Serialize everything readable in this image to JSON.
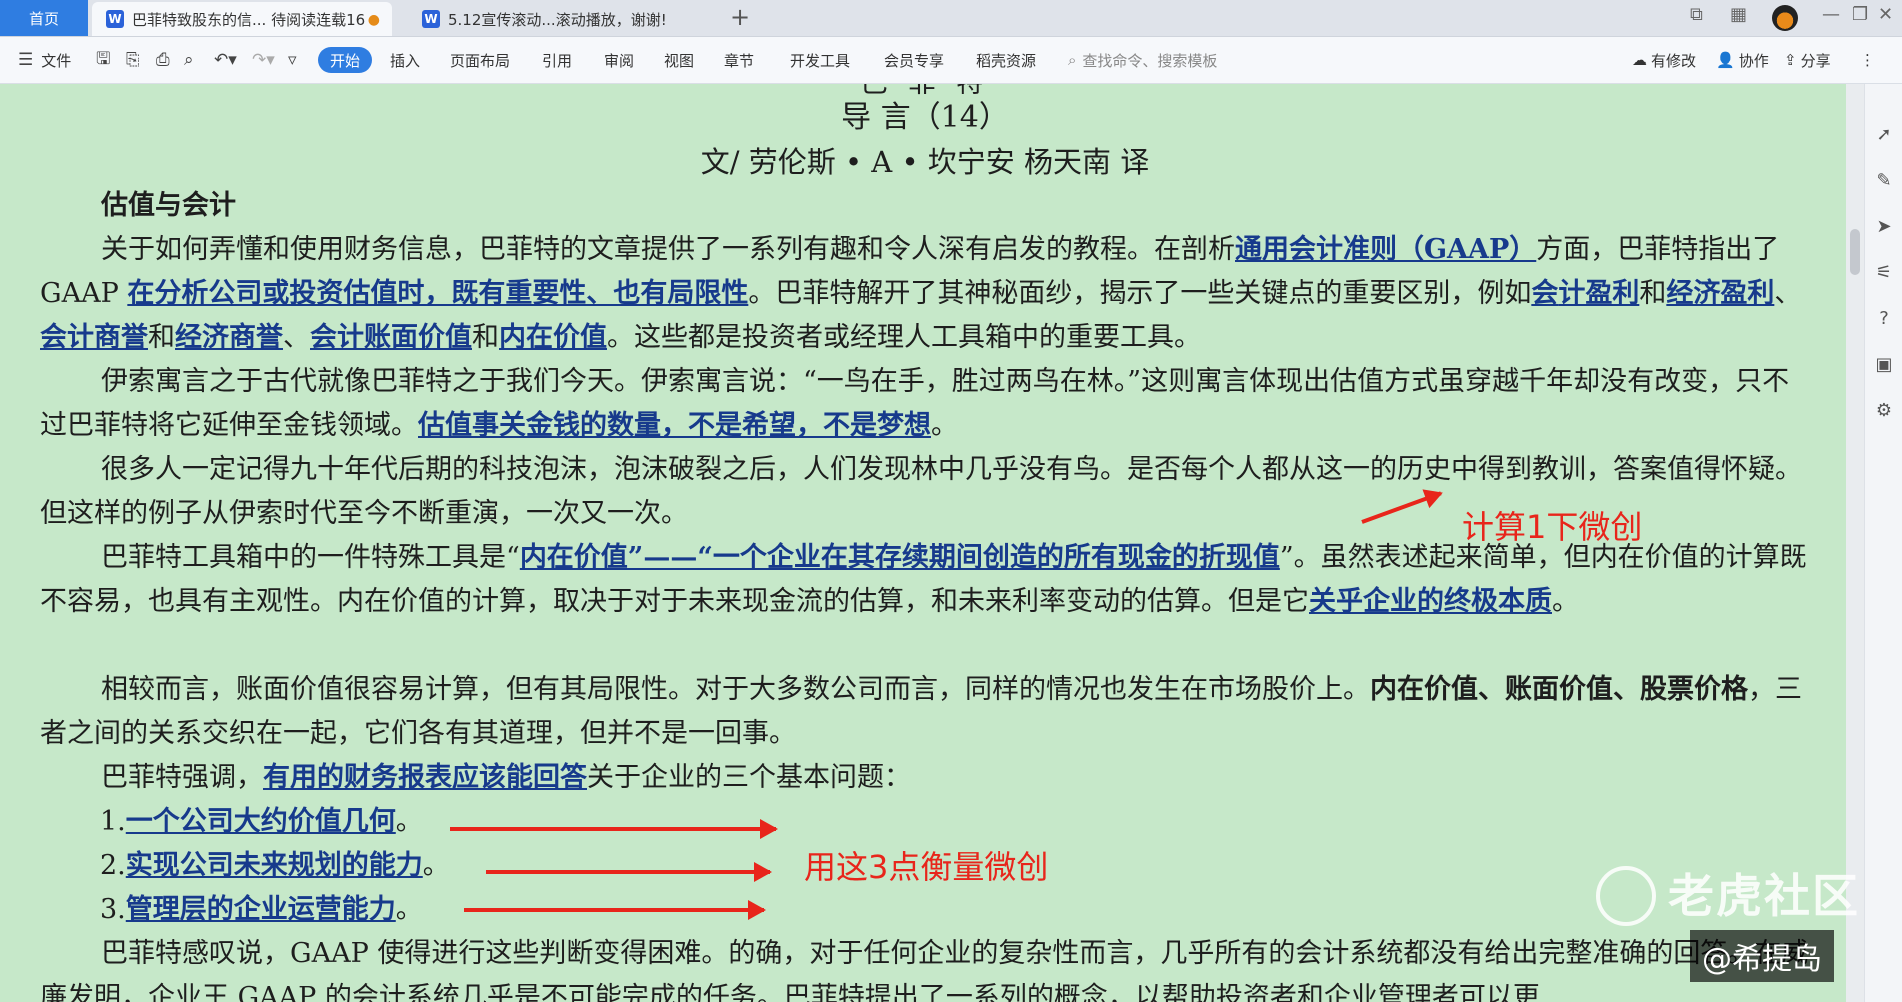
{
  "titlebar": {
    "home_tab": "首页",
    "tabs": [
      {
        "label": "巴菲特致股东的信... 待阅读连载16",
        "icon": "W",
        "modified": "●"
      },
      {
        "label": "5.12宣传滚动...滚动播放，谢谢!",
        "icon": "W"
      }
    ],
    "add_tab": "+"
  },
  "toolbar": {
    "file_menu": "文件",
    "menus": [
      "开始",
      "插入",
      "页面布局",
      "引用",
      "审阅",
      "视图",
      "章节",
      "开发工具",
      "会员专享",
      "稻壳资源"
    ],
    "search_placeholder": "查找命令、搜索模板",
    "right": {
      "changes": "有修改",
      "collab": "协作",
      "share": "分享"
    }
  },
  "document": {
    "heading_partial": "巴 菲 特",
    "heading": "导 言（14）",
    "byline": "文/ 劳伦斯 • A • 坎宁安   杨天南 译",
    "section_title": "估值与会计",
    "p1": {
      "a": "关于如何弄懂和使用财务信息，巴菲特的文章提供了一系列有趣和令人深有启发的教程。在剖析",
      "u1": "通用会计准则（GAAP）",
      "b": "方面，巴菲",
      "c": "特指出了 GAAP ",
      "u2": "在分析公司或投资估值时，既有重要性、也有局限性",
      "d": "。巴菲特解开了其神秘面纱，揭示了一些关键点的重要区别，例如",
      "u3": "会",
      "u3b": "计盈利",
      "and1": "和",
      "u4": "经济盈利",
      "sep1": "、",
      "u5": "会计商誉",
      "and2": "和",
      "u6": "经济商誉",
      "sep2": "、",
      "u7": "会计账面价值",
      "and3": "和",
      "u8": "内在价值",
      "e": "。这些都是投资者或经理人工具箱中的重要工具。"
    },
    "p2": {
      "a": "伊索寓言之于古代就像巴菲特之于我们今天。伊索寓言说：“一鸟在手，胜过两鸟在林。”这则寓言体现出估值方式虽穿越千年却",
      "b": "没有改变，只不过巴菲特将它延伸至金钱领域。",
      "u1": "估值事关金钱的数量，不是希望，不是梦想",
      "c": "。"
    },
    "p3": {
      "a": "很多人一定记得九十年代后期的科技泡沫，泡沫破裂之后，人们发现林中几乎没有鸟。是否每个人都从这一的历史中得到教训，答",
      "b": "案值得怀疑。但这样的例子从伊索时代至今不断重演，一次又一次。"
    },
    "p4": {
      "a": "巴菲特工具箱中的一件特殊工具是“",
      "u1": "内在价值”——“一个企业在其存续期间创造的所有现金的折现值",
      "b": "”。虽然表述起来简单，但",
      "c": "内在价值的计算既不容易，也具有主观性。内在价值的计算，取决于对于未来现金流的估算，和未来利率变动的估算。但是它",
      "u2": "关乎企业",
      "u2b": "的终极本质",
      "d": "。"
    },
    "p5": {
      "a": "相较而言，账面价值很容易计算，但有其局限性。对于大多数公司而言，同样的情况也发生在市场股价上。",
      "b1": "内在价值、账面价值、",
      "b2": "股票价格",
      "c": "，三者之间的关系交织在一起，它们各有其道理，但并不是一回事。"
    },
    "p6": {
      "a": "巴菲特强调，",
      "u1": "有用的财务报表应该能回答",
      "b": "关于企业的三个基本问题："
    },
    "list": [
      {
        "num": "1.",
        "text": "一个公司大约价值几何",
        "end": "。"
      },
      {
        "num": "2.",
        "text": "实现公司未来规划的能力",
        "end": "。"
      },
      {
        "num": "3.",
        "text": "管理层的企业运营能力",
        "end": "。"
      }
    ],
    "p7": {
      "a": "巴菲特感叹说，GAAP 使得进行这些判断变得困难。的确，对于任何企业的复杂性而言，几乎所有的会计系统都没有给出完整准确的",
      "b": "回答。在威廉发明，企业王 GAAP 的会计系统几乎是不可能完成的任务。巴菲特提出了一系列的概念，以帮助投资者和企业管理者可以更"
    }
  },
  "annotations": {
    "calc": "计算1下微创",
    "three_points": "用这3点衡量微创",
    "color": "#e8251b"
  },
  "overlay": {
    "watermark": "老虎社区",
    "channel": "@希提岛"
  }
}
